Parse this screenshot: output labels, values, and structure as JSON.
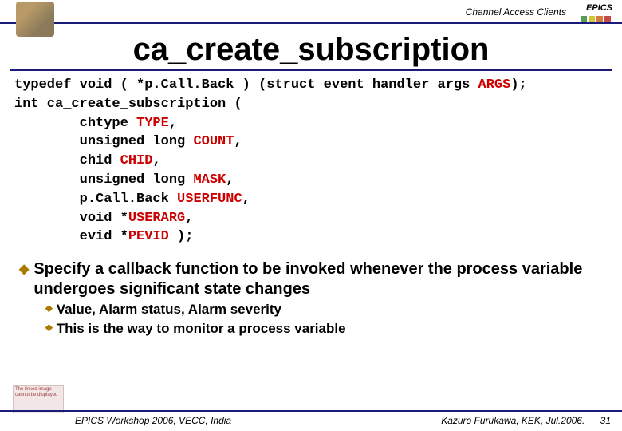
{
  "header": {
    "label": "Channel Access Clients",
    "epics": "EPICS"
  },
  "title": "ca_create_subscription",
  "code": {
    "l1a": "typedef void ( *p.Call.Back ) (struct event_handler_args ",
    "l1b": "ARGS",
    "l1c": ");",
    "l2": "int ca_create_subscription (",
    "l3a": "        chtype ",
    "l3b": "TYPE",
    "l3c": ",",
    "l4a": "        unsigned long ",
    "l4b": "COUNT",
    "l4c": ",",
    "l5a": "        chid ",
    "l5b": "CHID",
    "l5c": ",",
    "l6a": "        unsigned long ",
    "l6b": "MASK",
    "l6c": ",",
    "l7a": "        p.Call.Back ",
    "l7b": "USERFUNC",
    "l7c": ",",
    "l8a": "        void *",
    "l8b": "USERARG",
    "l8c": ",",
    "l9a": "        evid *",
    "l9b": "PEVID",
    "l9c": " );"
  },
  "bullets": {
    "main": "Specify a callback function to be invoked whenever the process variable undergoes significant state changes",
    "sub1": "Value, Alarm status, Alarm severity",
    "sub2": "This is the way to monitor a process variable"
  },
  "footer": {
    "left": "EPICS Workshop 2006, VECC, India",
    "right": "Kazuro Furukawa, KEK, Jul.2006.",
    "page": "31",
    "logobox": "The linked image cannot be displayed"
  }
}
